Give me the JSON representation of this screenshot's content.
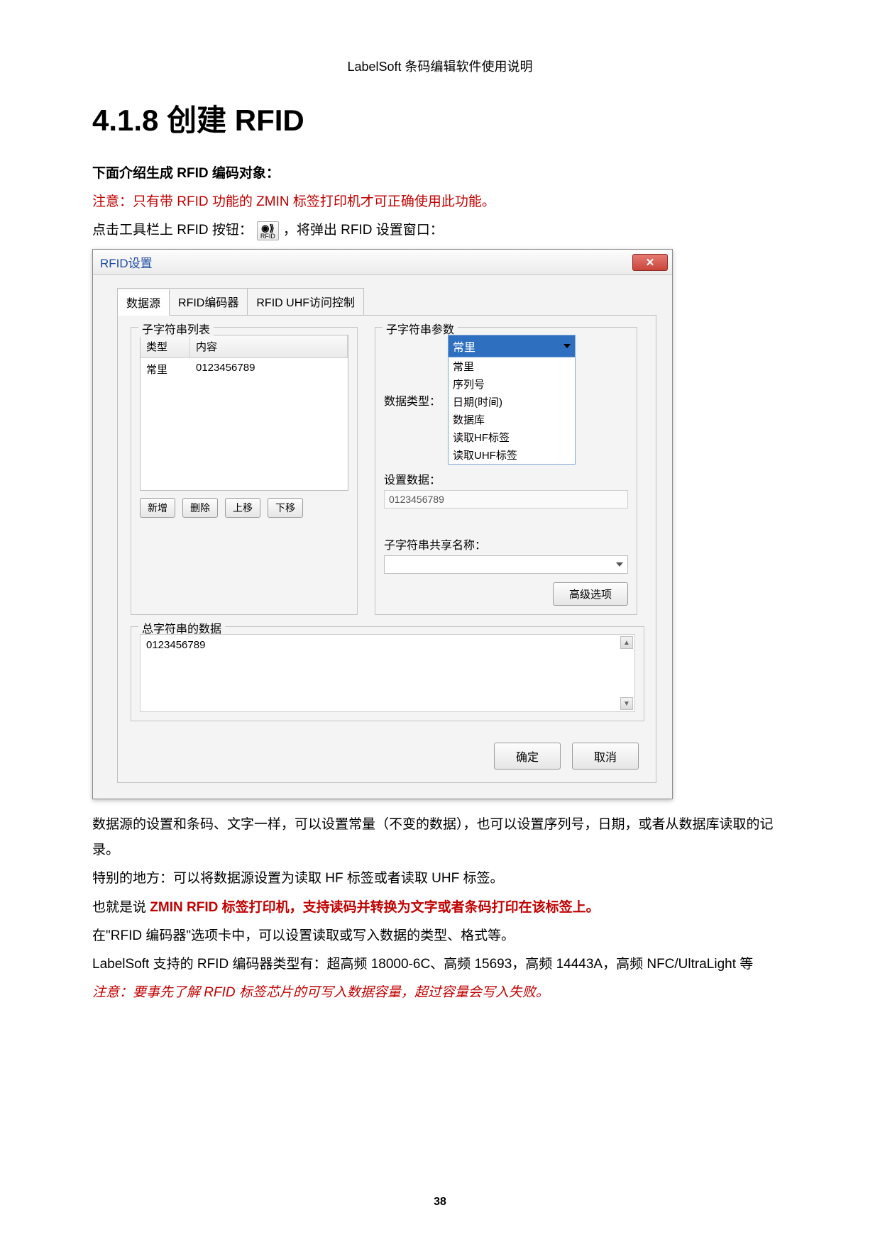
{
  "header_note": "LabelSoft 条码编辑软件使用说明",
  "section_title": "4.1.8 创建 RFID",
  "intro_bold": "下面介绍生成 RFID 编码对象：",
  "warning1": "注意：只有带 RFID 功能的 ZMIN 标签打印机才可正确使用此功能。",
  "toolbar_before": "点击工具栏上 RFID 按钮：",
  "toolbar_icon_caption": "RFID",
  "toolbar_after": "，将弹出 RFID 设置窗口：",
  "dialog": {
    "title": "RFID设置",
    "close": "✕",
    "tabs": [
      "数据源",
      "RFID编码器",
      "RFID UHF访问控制"
    ],
    "left": {
      "legend": "子字符串列表",
      "headers": [
        "类型",
        "内容"
      ],
      "row": [
        "常里",
        "0123456789"
      ],
      "buttons": [
        "新增",
        "删除",
        "上移",
        "下移"
      ]
    },
    "right": {
      "legend": "子字符串参数",
      "data_type_label": "数据类型：",
      "data_type_selected": "常里",
      "data_type_options": [
        "常里",
        "序列号",
        "日期(时间)",
        "数据库",
        "读取HF标签",
        "读取UHF标签"
      ],
      "set_data_label": "设置数据：",
      "set_data_value": "0123456789",
      "share_label": "子字符串共享名称：",
      "advanced": "高级选项"
    },
    "total": {
      "legend": "总字符串的数据",
      "value": "0123456789"
    },
    "ok": "确定",
    "cancel": "取消"
  },
  "after1": "数据源的设置和条码、文字一样，可以设置常量（不变的数据），也可以设置序列号，日期，或者从数据库读取的记录。",
  "after2": "特别的地方：可以将数据源设置为读取 HF 标签或者读取 UHF 标签。",
  "after3_pre": "也就是说 ",
  "after3_red": "ZMIN RFID 标签打印机，支持读码并转换为文字或者条码打印在该标签上。",
  "after4": "在\"RFID 编码器\"选项卡中，可以设置读取或写入数据的类型、格式等。",
  "after5": "LabelSoft 支持的 RFID 编码器类型有：超高频 18000-6C、高频 15693，高频 14443A，高频 NFC/UltraLight 等",
  "warning2": "注意：要事先了解 RFID 标签芯片的可写入数据容量，超过容量会写入失败。",
  "page_number": "38"
}
